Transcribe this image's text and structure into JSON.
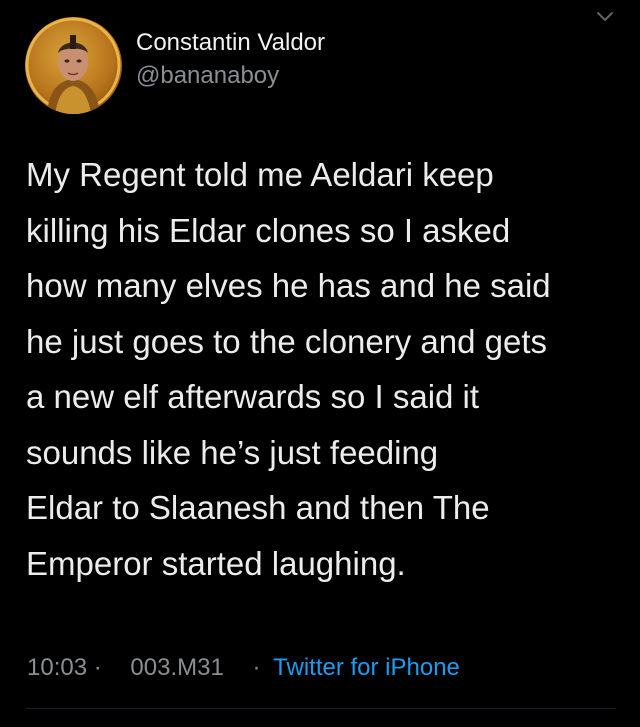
{
  "author": {
    "display_name": "Constantin Valdor",
    "handle": "@bananaboy"
  },
  "tweet": {
    "lines": [
      "My Regent  told me  Aeldari keep",
      "killing  his  Eldar clones  so I asked",
      "how many elves he has and he said",
      "he just goes to the clonery and gets",
      "a new  elf  afterwards so I said it",
      "sounds like he’s just feeding",
      "Eldar to Slaanesh and then The",
      "Emperor  started laughing."
    ]
  },
  "meta": {
    "time": "10:03",
    "separator_1": "·",
    "date": "003.M31",
    "separator_2": "·",
    "source": "Twitter for iPhone"
  },
  "icons": {
    "caret": "chevron-down-icon",
    "avatar": "avatar-portrait"
  },
  "colors": {
    "background": "#000000",
    "text": "#ececec",
    "secondary_text": "#8a8f94",
    "link": "#1d9bf0"
  }
}
